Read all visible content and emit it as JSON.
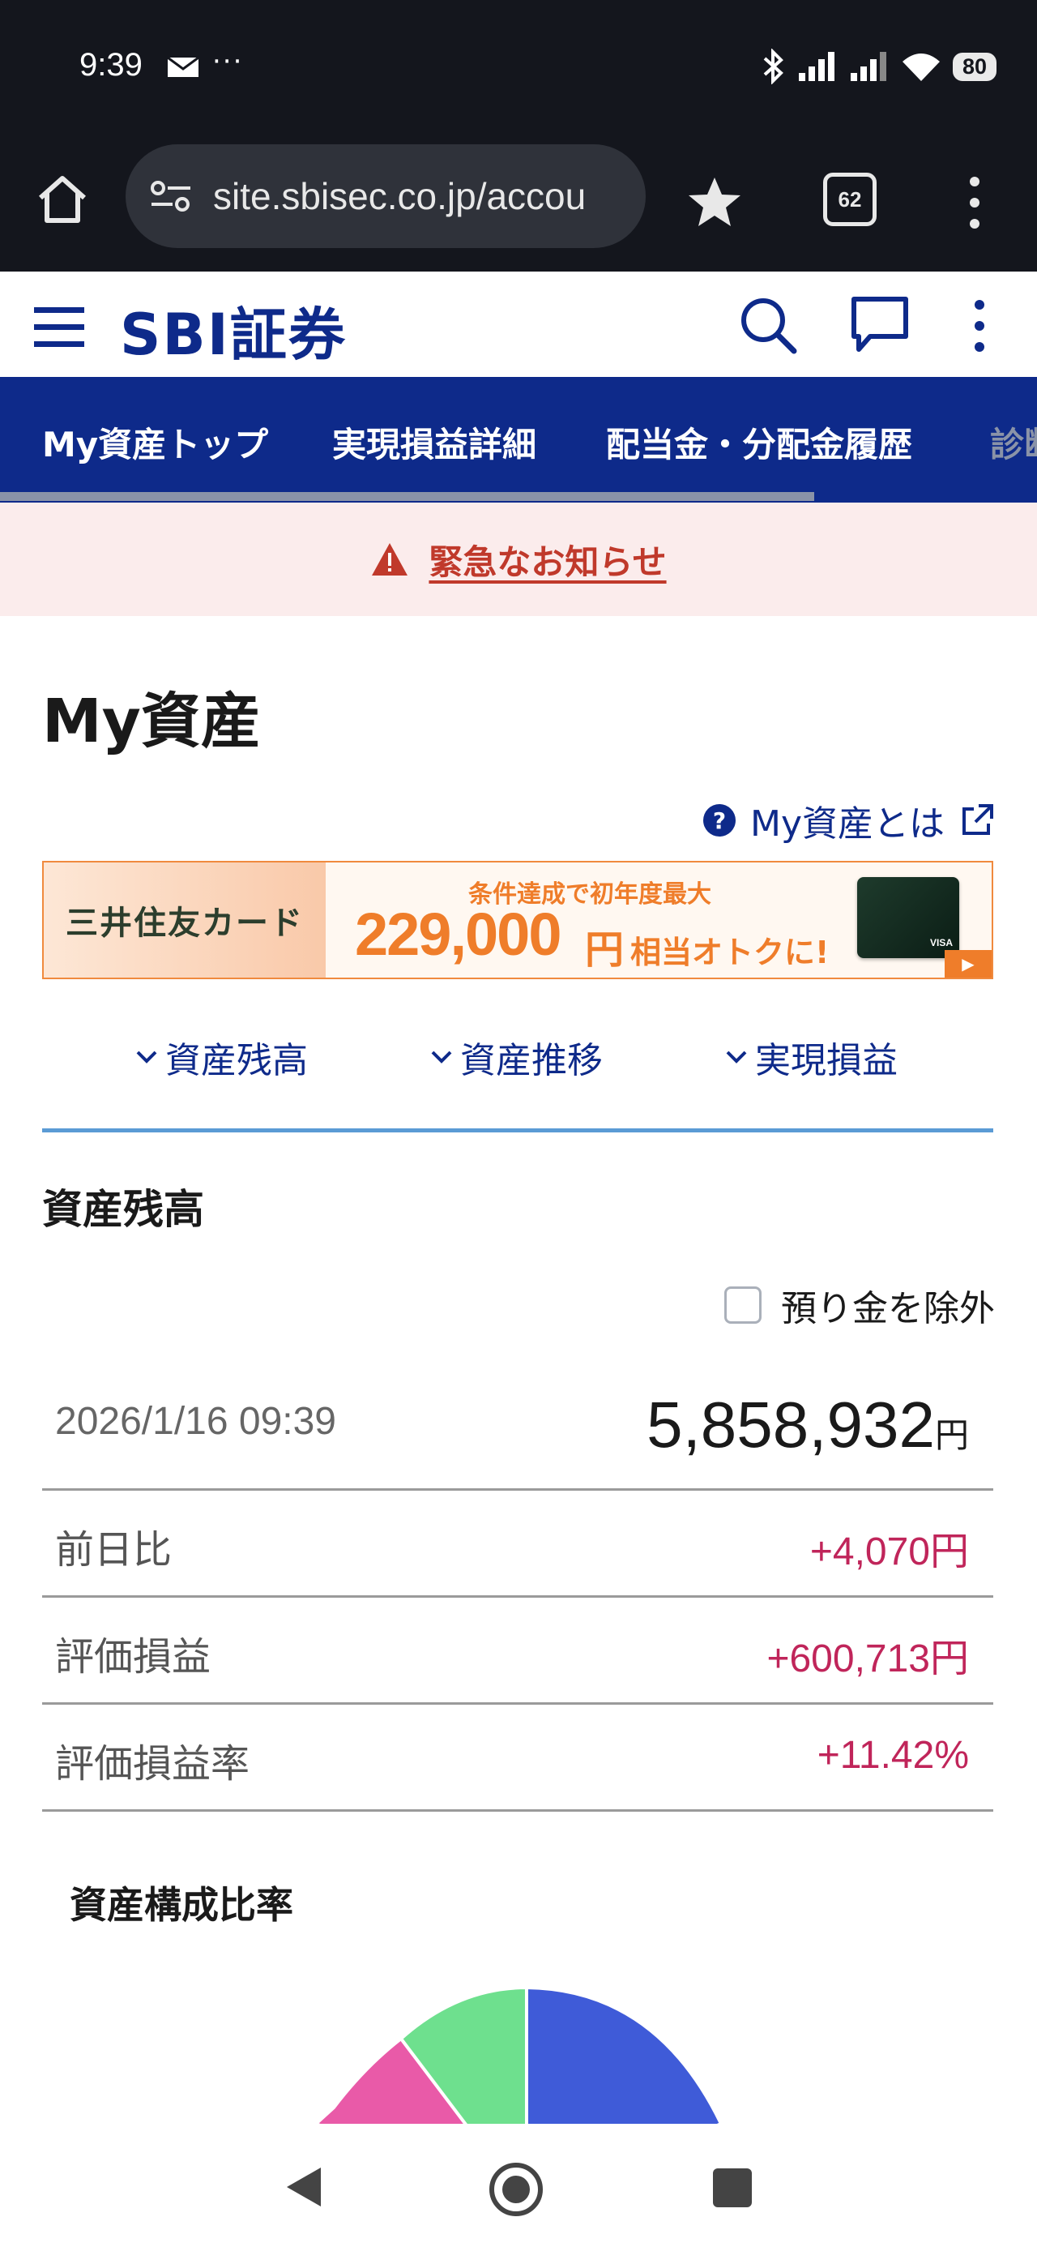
{
  "status_bar": {
    "time": "9:39",
    "dots": "···",
    "battery": "80"
  },
  "browser": {
    "url": "site.sbisec.co.jp/accou",
    "tab_count": "62"
  },
  "site": {
    "logo": "SBI証券"
  },
  "nav": {
    "tabs": [
      "My資産トップ",
      "実現損益詳細",
      "配当金・分配金履歴",
      "診断"
    ]
  },
  "alert": {
    "text": "緊急なお知らせ"
  },
  "page": {
    "title": "My資産",
    "what_link": "My資産とは"
  },
  "banner": {
    "brand": "三井住友カード",
    "subtitle": "条件達成で初年度最大",
    "amount": "229,000",
    "unit": "円",
    "deal": "相当オトクに!",
    "card_brand": "VISA"
  },
  "anchors": [
    "資産残高",
    "資産推移",
    "実現損益"
  ],
  "balance": {
    "section_title": "資産残高",
    "exclude_label": "預り金を除外",
    "date": "2026/1/16 09:39",
    "total": "5,858,932",
    "total_unit": "円",
    "stats": [
      {
        "label": "前日比",
        "value": "+4,070円"
      },
      {
        "label": "評価損益",
        "value": "+600,713円"
      },
      {
        "label": "評価損益率",
        "value": "+11.42%"
      }
    ]
  },
  "composition": {
    "title": "資産構成比率",
    "slice_colors": [
      "#e95aa8",
      "#6ee08e",
      "#3f5bd8"
    ]
  },
  "colors": {
    "brand": "#0e2a8a",
    "positive": "#c0255a",
    "alert": "#c0392b",
    "accent": "#ef7d2a"
  }
}
